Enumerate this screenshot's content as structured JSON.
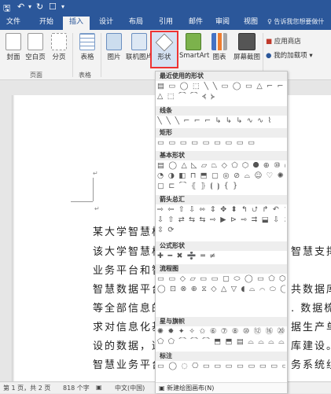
{
  "titlebar": {
    "save_icon": "save-icon",
    "undo_icon": "undo-icon",
    "redo_icon": "redo-icon",
    "touch_icon": "touch-mode-icon",
    "customize_icon": "customize-qa-icon"
  },
  "tabs": [
    "文件",
    "开始",
    "插入",
    "设计",
    "布局",
    "引用",
    "邮件",
    "审阅",
    "视图"
  ],
  "active_tab": "插入",
  "tell_me": "告诉我您想要做什",
  "ribbon": {
    "buttons": {
      "cover": "封面",
      "blank": "空白页",
      "pagebreak": "分页",
      "table": "表格",
      "picture": "图片",
      "online_picture": "联机图片",
      "shapes": "形状",
      "smartart": "SmartArt",
      "chart": "图表",
      "screenshot": "屏幕截图",
      "store": "应用商店",
      "my_addins": "我的加载项"
    },
    "groups": {
      "pages": "页面",
      "tables": "表格"
    }
  },
  "document": {
    "cursor_mark": "↵",
    "lines_left": [
      "某大学智慧校",
      "该大学智慧校",
      "业务平台和智",
      "智慧数据平台",
      "等全部信息的",
      "求对信息化基",
      "设的数据，逐",
      "智慧业务平台"
    ],
    "lines_right": [
      "",
      "智慧支撑",
      "",
      "共数据库",
      ". 数据梳",
      "据生产单",
      "库建设。",
      "务系统组"
    ]
  },
  "statusbar": {
    "page": "第 1 页，共 2 页",
    "words": "818 个字",
    "language": "中文(中国)"
  },
  "gallery": {
    "sections": [
      {
        "title": "最近使用的形状",
        "rows": [
          "▤ ▭ ◯ ⬚ ╲ ╲ ▭ ◯ ▭ △ ⌐ ⌐ ⇨ ⇩ ↰",
          "△ ⬚ ⌒ ⌒ ⦓ ⦔"
        ]
      },
      {
        "title": "线条",
        "rows": [
          "╲ ╲ ╲ ⌐ ⌐ ⌐ ↳ ↳ ↳ ∿ ∿ ⌇"
        ]
      },
      {
        "title": "矩形",
        "rows": [
          "▭ ▭ ▭ ▭ ▭ ▭ ▭ ▭ ▭"
        ]
      },
      {
        "title": "基本形状",
        "rows": [
          "▤ ◯ △ ◺ ▱ ⏢ ◇ ⬠ ⬡ ⯃ ⊕ ⑩ ⑫",
          "◔ ◑ ◧ ⊓ ⬒ ▢ ◎ ⊘ ⌓ ☺ ♡ ✺ ☾ ☁",
          "▢ ⊏ ⌒ ⦃ ⦄ ⦗ ⦘ { }"
        ]
      },
      {
        "title": "箭头总汇",
        "rows": [
          "⇨ ⇦ ⇧ ⇩ ⬄ ⇕ ✥ ⬍ ↰ ⮍ ↱ ↶ ⇪ ⇨",
          "⇩ ⇧ ⇄ ⇆ ⇆ ⇨ ▶ ⊳ ⇨ ⮆ ⬓ ⇩ ⇫ ⬜",
          "⇳ ⟳"
        ]
      },
      {
        "title": "公式形状",
        "rows": [
          "✚ ━ ✖ ➗ ═ ≠"
        ]
      },
      {
        "title": "流程图",
        "rows": [
          "▭ ▭ ◇ ▱ ▭ ▭ ▢ ⬭ ◯ ▭ ⬠ ⬡ ▭",
          "◯ ⊡ ⊗ ⊕ ⧖ ◇ △ ▽ ◖ ⌓ ⌒ ⬭ ◯ ▭"
        ]
      },
      {
        "title": "星与旗帜",
        "rows": [
          "✺ ✹ ✦ ✧ ✩ ⑥ ⑦ ⑧ ⑩ ⑫ ⑯ ⑳ ㉔ ㉜",
          "⬠ ⬠ ⌒ ⌒ ⌒ ⬒ ⬒ ▤ ⌓ ⌓ ⌓ ⌓"
        ]
      },
      {
        "title": "标注",
        "rows": [
          "▭ ◯ ◌ ⎔ ▭ ▭ ▭ ▭ ▭ ▭ ▭ ▭"
        ]
      }
    ],
    "new_canvas": "新建绘图画布(N)"
  }
}
